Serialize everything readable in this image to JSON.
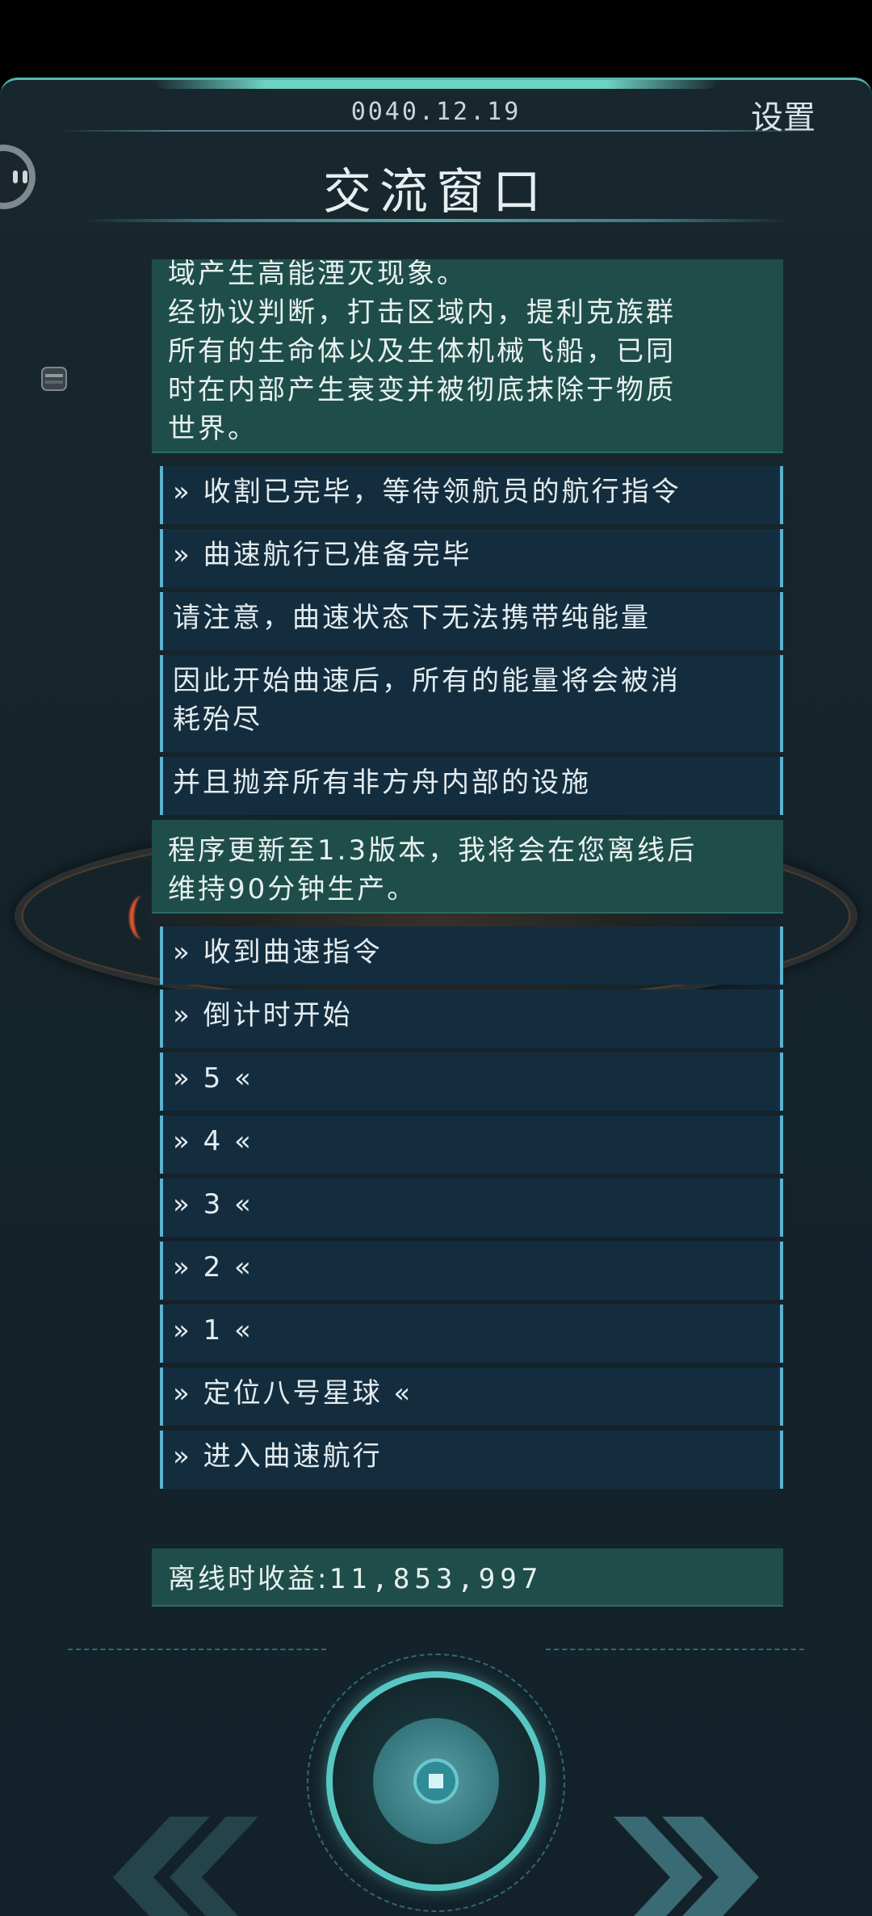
{
  "header": {
    "date": "0040.12.19",
    "settings_label": "设置",
    "title": "交流窗口"
  },
  "messages": [
    {
      "type": "green",
      "lines": [
        "域产生高能湮灭现象。",
        "经协议判断，打击区域内，提利克族群",
        "所有的生命体以及生体机械飞船，已同",
        "时在内部产生衰变并被彻底抹除于物质",
        "世界。"
      ]
    },
    {
      "type": "blue",
      "lines": [
        "» 收割已完毕，等待领航员的航行指令"
      ]
    },
    {
      "type": "blue",
      "lines": [
        "» 曲速航行已准备完毕"
      ]
    },
    {
      "type": "blue",
      "lines": [
        "请注意，曲速状态下无法携带纯能量"
      ]
    },
    {
      "type": "blue",
      "lines": [
        "因此开始曲速后，所有的能量将会被消",
        "耗殆尽"
      ]
    },
    {
      "type": "blue",
      "lines": [
        "并且抛弃所有非方舟内部的设施"
      ]
    },
    {
      "type": "green",
      "lines": [
        "程序更新至1.3版本，我将会在您离线后",
        "维持90分钟生产。"
      ]
    },
    {
      "type": "blue",
      "lines": [
        "» 收到曲速指令"
      ]
    },
    {
      "type": "blue",
      "lines": [
        "» 倒计时开始"
      ]
    },
    {
      "type": "blue",
      "lines": [
        "» 5 «"
      ]
    },
    {
      "type": "blue",
      "lines": [
        "» 4 «"
      ]
    },
    {
      "type": "blue",
      "lines": [
        "» 3 «"
      ]
    },
    {
      "type": "blue",
      "lines": [
        "» 2 «"
      ]
    },
    {
      "type": "blue",
      "lines": [
        "» 1 «"
      ]
    },
    {
      "type": "blue",
      "lines": [
        "» 定位八号星球 «"
      ]
    },
    {
      "type": "blue",
      "lines": [
        "» 进入曲速航行"
      ]
    }
  ],
  "offline": {
    "label": "离线时收益:",
    "value": "11,853,997"
  },
  "controls": {
    "prev_icon": "double-chevron-left-icon",
    "next_icon": "double-chevron-right-icon",
    "center_icon": "power-core-icon"
  },
  "colors": {
    "accent": "#58c7c2",
    "green_box": "#1f4e4a",
    "blue_box": "#142d3e",
    "blue_border": "#5cb0d0"
  }
}
